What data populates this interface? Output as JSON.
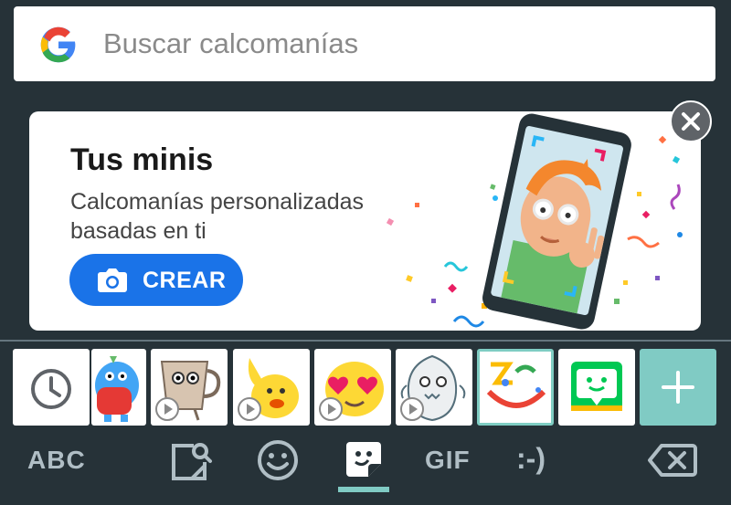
{
  "search": {
    "placeholder": "Buscar calcomanías"
  },
  "promo": {
    "title": "Tus minis",
    "subtitle": "Calcomanías personalizadas basadas en ti",
    "button_label": "CREAR",
    "accent_color": "#1a73e8"
  },
  "sticker_strip": {
    "items": [
      {
        "icon": "recent-clock-icon"
      },
      {
        "icon": "blue-creature-sticker"
      },
      {
        "icon": "coffee-cup-sticker",
        "animated": true
      },
      {
        "icon": "waving-blob-sticker",
        "animated": true
      },
      {
        "icon": "heart-eyes-sticker",
        "animated": true
      },
      {
        "icon": "shark-sticker",
        "animated": true
      },
      {
        "icon": "minis-face-sticker",
        "selected": true
      },
      {
        "icon": "bitmoji-sticker"
      },
      {
        "icon": "add-icon"
      }
    ]
  },
  "bottom_bar": {
    "abc_label": "ABC",
    "gif_label": "GIF",
    "emoticon_label": ":-)",
    "active_tab": "stickers",
    "accent_color": "#80cbc4"
  }
}
